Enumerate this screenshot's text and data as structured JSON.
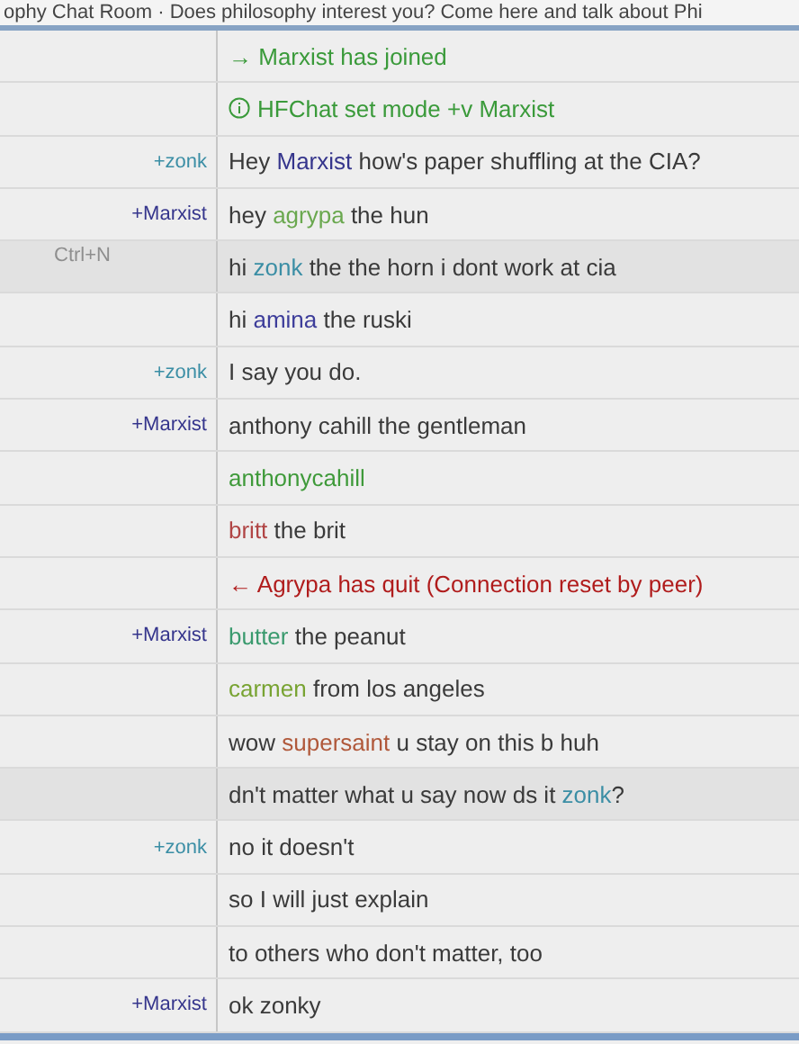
{
  "topic": "ophy Chat Room · Does philosophy interest you? Come here and talk about Phi",
  "rows": [
    {
      "kind": "join",
      "highlighted": false,
      "parts": [
        {
          "text": "→ Marxist has joined"
        }
      ]
    },
    {
      "kind": "mode",
      "highlighted": false,
      "parts": [
        {
          "text": "HFChat set mode +v Marxist"
        }
      ]
    },
    {
      "kind": "message",
      "highlighted": false,
      "nick": {
        "text": "+zonk",
        "color": "#3b8ea5"
      },
      "parts": [
        {
          "text": "Hey "
        },
        {
          "text": "Marxist",
          "color": "#35358c"
        },
        {
          "text": " how's paper shuffling at the CIA?"
        }
      ]
    },
    {
      "kind": "message",
      "highlighted": false,
      "nick": {
        "text": "+Marxist",
        "color": "#35358c"
      },
      "parts": [
        {
          "text": "hey "
        },
        {
          "text": "agrypa",
          "color": "#6aa84f"
        },
        {
          "text": " the hun"
        }
      ]
    },
    {
      "kind": "message",
      "highlighted": true,
      "hint": "Ctrl+N",
      "parts": [
        {
          "text": "hi "
        },
        {
          "text": "zonk",
          "color": "#3b8ea5"
        },
        {
          "text": " the the horn i dont work at cia"
        }
      ]
    },
    {
      "kind": "message",
      "highlighted": false,
      "parts": [
        {
          "text": "hi "
        },
        {
          "text": "amina",
          "color": "#3d3d9a"
        },
        {
          "text": " the ruski"
        }
      ]
    },
    {
      "kind": "message",
      "highlighted": false,
      "nick": {
        "text": "+zonk",
        "color": "#3b8ea5"
      },
      "parts": [
        {
          "text": "I say you do."
        }
      ]
    },
    {
      "kind": "message",
      "highlighted": false,
      "nick": {
        "text": "+Marxist",
        "color": "#35358c"
      },
      "parts": [
        {
          "text": "anthony cahill the gentleman"
        }
      ]
    },
    {
      "kind": "message",
      "highlighted": false,
      "parts": [
        {
          "text": "anthonycahill",
          "color": "#3f9a3a"
        }
      ]
    },
    {
      "kind": "message",
      "highlighted": false,
      "parts": [
        {
          "text": "britt",
          "color": "#b04545"
        },
        {
          "text": " the brit"
        }
      ]
    },
    {
      "kind": "quit",
      "highlighted": false,
      "parts": [
        {
          "text": "← Agrypa has quit (Connection reset by peer)"
        }
      ]
    },
    {
      "kind": "message",
      "highlighted": false,
      "nick": {
        "text": "+Marxist",
        "color": "#35358c"
      },
      "parts": [
        {
          "text": "butter",
          "color": "#3a9a6e"
        },
        {
          "text": " the peanut"
        }
      ]
    },
    {
      "kind": "message",
      "highlighted": false,
      "parts": [
        {
          "text": "carmen",
          "color": "#78a332"
        },
        {
          "text": " from los angeles"
        }
      ]
    },
    {
      "kind": "message",
      "highlighted": false,
      "parts": [
        {
          "text": "wow "
        },
        {
          "text": "supersaint",
          "color": "#b0583a"
        },
        {
          "text": " u stay on this b huh"
        }
      ]
    },
    {
      "kind": "message",
      "highlighted": true,
      "parts": [
        {
          "text": "dn't matter what u say now ds it "
        },
        {
          "text": "zonk",
          "color": "#3b8ea5"
        },
        {
          "text": "?"
        }
      ]
    },
    {
      "kind": "message",
      "highlighted": false,
      "nick": {
        "text": "+zonk",
        "color": "#3b8ea5"
      },
      "parts": [
        {
          "text": "no it doesn't"
        }
      ]
    },
    {
      "kind": "message",
      "highlighted": false,
      "parts": [
        {
          "text": "so I will just explain"
        }
      ]
    },
    {
      "kind": "message",
      "highlighted": false,
      "parts": [
        {
          "text": "to others who don't matter, too"
        }
      ]
    },
    {
      "kind": "message",
      "highlighted": false,
      "nick": {
        "text": "+Marxist",
        "color": "#35358c"
      },
      "parts": [
        {
          "text": "ok zonky"
        }
      ]
    }
  ]
}
